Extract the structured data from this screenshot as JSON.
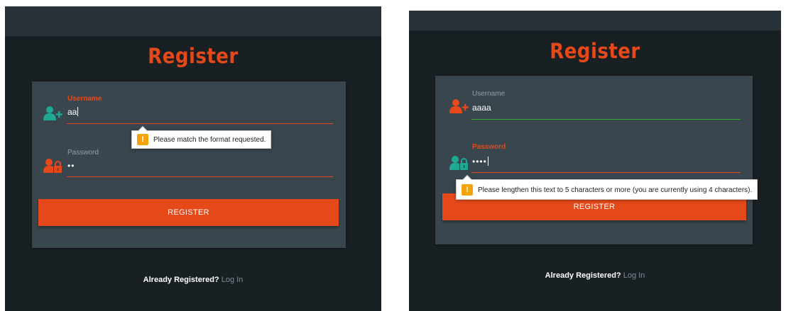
{
  "panels": [
    {
      "title": "Register",
      "username": {
        "label": "Username",
        "value": "aa",
        "label_state": "error",
        "underline_color": "#e5491a"
      },
      "password": {
        "label": "Password",
        "value": "••",
        "label_state": "normal",
        "underline_color": "#e5491a"
      },
      "register_label": "REGISTER",
      "footer_question": "Already Registered?",
      "footer_link": "Log In",
      "tooltip": {
        "text": "Please match the format requested.",
        "warn_glyph": "!"
      },
      "colors": {
        "user_icon": "#1fa894",
        "lock_icon": "#e5491a"
      }
    },
    {
      "title": "Register",
      "username": {
        "label": "Username",
        "value": "aaaa",
        "label_state": "normal",
        "underline_color": "#3aa832"
      },
      "password": {
        "label": "Password",
        "value": "••••",
        "label_state": "error",
        "underline_color": "#e5491a"
      },
      "register_label": "REGISTER",
      "footer_question": "Already Registered?",
      "footer_link": "Log In",
      "tooltip": {
        "text": "Please lengthen this text to 5 characters or more (you are currently using 4 characters).",
        "warn_glyph": "!"
      },
      "colors": {
        "user_icon": "#e5491a",
        "lock_icon": "#1fa894"
      }
    }
  ],
  "colors": {
    "accent": "#e5491a",
    "background": "#192024",
    "topbar": "#283238",
    "card": "#39464e",
    "success": "#3aa832",
    "warning": "#f5a30a"
  }
}
